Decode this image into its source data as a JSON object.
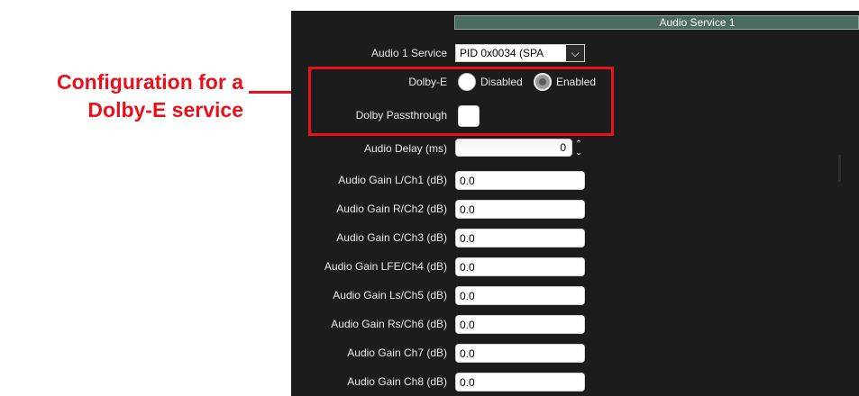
{
  "annotation": {
    "line1": "Configuration for a",
    "line2": "Dolby-E service"
  },
  "header": {
    "title": "Audio Service 1"
  },
  "service": {
    "label": "Audio 1 Service",
    "selected": "PID 0x0034 (SPA"
  },
  "dolby_e": {
    "label": "Dolby-E",
    "options": [
      "Disabled",
      "Enabled"
    ],
    "selected": "Enabled"
  },
  "passthrough": {
    "label": "Dolby Passthrough",
    "checked": false
  },
  "delay": {
    "label": "Audio Delay (ms)",
    "value": "0"
  },
  "gains": [
    {
      "label": "Audio Gain L/Ch1 (dB)",
      "value": "0.0"
    },
    {
      "label": "Audio Gain R/Ch2 (dB)",
      "value": "0.0"
    },
    {
      "label": "Audio Gain C/Ch3 (dB)",
      "value": "0.0"
    },
    {
      "label": "Audio Gain LFE/Ch4 (dB)",
      "value": "0.0"
    },
    {
      "label": "Audio Gain Ls/Ch5 (dB)",
      "value": "0.0"
    },
    {
      "label": "Audio Gain Rs/Ch6 (dB)",
      "value": "0.0"
    },
    {
      "label": "Audio Gain Ch7 (dB)",
      "value": "0.0"
    },
    {
      "label": "Audio Gain Ch8 (dB)",
      "value": "0.0"
    }
  ],
  "colors": {
    "annotation": "#e8101a",
    "panel": "#1c1c1c",
    "header": "#4c6b63"
  }
}
